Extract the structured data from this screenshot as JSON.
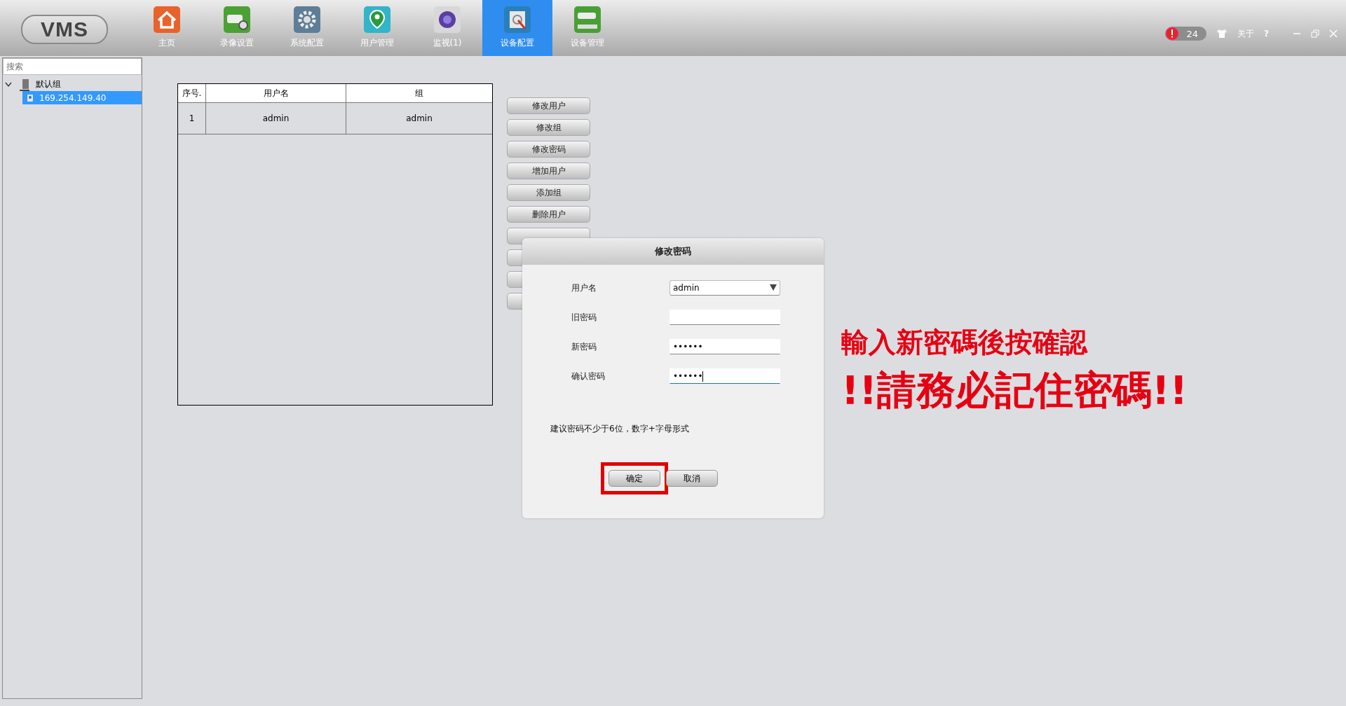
{
  "app": {
    "logo": "VMS"
  },
  "nav": [
    {
      "label": "主页",
      "selected": false
    },
    {
      "label": "录像设置",
      "selected": false
    },
    {
      "label": "系统配置",
      "selected": false
    },
    {
      "label": "用户管理",
      "selected": false
    },
    {
      "label": "监视(1)",
      "selected": false
    },
    {
      "label": "设备配置",
      "selected": true
    },
    {
      "label": "设备管理",
      "selected": false
    }
  ],
  "status": {
    "alarm_count": "24",
    "about": "关于",
    "help": "?"
  },
  "sidebar": {
    "search": {
      "placeholder": "搜索"
    },
    "tree": [
      {
        "label": "默认组",
        "expanded": true,
        "selected": false,
        "children": [
          {
            "label": "169.254.149.40",
            "selected": true
          }
        ]
      }
    ]
  },
  "table": {
    "columns": [
      "序号.",
      "用户名",
      "组"
    ],
    "rows": [
      [
        "1",
        "admin",
        "admin"
      ]
    ]
  },
  "actions": [
    {
      "kind": "button",
      "label": "修改用户"
    },
    {
      "kind": "button",
      "label": "修改组"
    },
    {
      "kind": "button",
      "label": "修改密码"
    },
    {
      "kind": "button",
      "label": "增加用户"
    },
    {
      "kind": "button",
      "label": "添加组"
    },
    {
      "kind": "button",
      "label": "删除用户"
    },
    {
      "kind": "covered"
    },
    {
      "kind": "covered"
    },
    {
      "kind": "covered"
    },
    {
      "kind": "covered"
    }
  ],
  "dialog": {
    "title": "修改密码",
    "fields": [
      {
        "label": "用户名",
        "kind": "select",
        "value": "admin",
        "focused": false
      },
      {
        "label": "旧密码",
        "kind": "text",
        "focused": false
      },
      {
        "label": "新密码",
        "kind": "text",
        "value": "••••••",
        "focused": false
      },
      {
        "label": "确认密码",
        "kind": "text",
        "value": "••••••",
        "focused": true
      }
    ],
    "hint": "建议密码不少于6位，数字+字母形式",
    "buttons": [
      {
        "label": "确定",
        "highlighted": true
      },
      {
        "label": "取消",
        "highlighted": false
      }
    ]
  },
  "annotation": {
    "lines": [
      "輸入新密碼後按確認",
      "!!請務必記住密碼!!"
    ]
  }
}
